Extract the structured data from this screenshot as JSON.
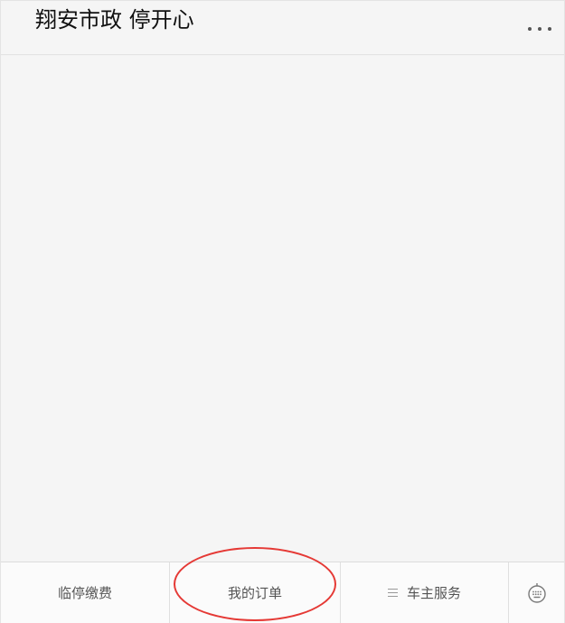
{
  "header": {
    "title": "翔安市政 停开心"
  },
  "menu": {
    "items": [
      {
        "label": "临停缴费"
      },
      {
        "label": "我的订单"
      },
      {
        "label": "车主服务"
      }
    ]
  },
  "colors": {
    "background": "#f5f5f5",
    "annotation": "#e53935"
  },
  "icons": {
    "more": "more-dots-icon",
    "submenu": "list-icon",
    "keyboard": "keyboard-icon"
  }
}
